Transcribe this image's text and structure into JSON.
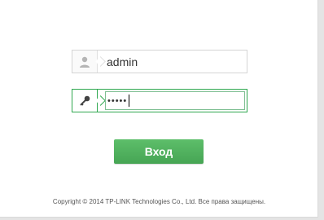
{
  "login": {
    "username_value": "admin",
    "password_mask": "•••••",
    "button_label": "Вход"
  },
  "footer": {
    "copyright": "Copyright © 2014 TP-LINK Technologies Co., Ltd. Все права защищены."
  },
  "icons": {
    "user": "user-icon",
    "key": "key-icon"
  },
  "colors": {
    "accent_green": "#46a554",
    "focus_border": "#2fa84f"
  }
}
